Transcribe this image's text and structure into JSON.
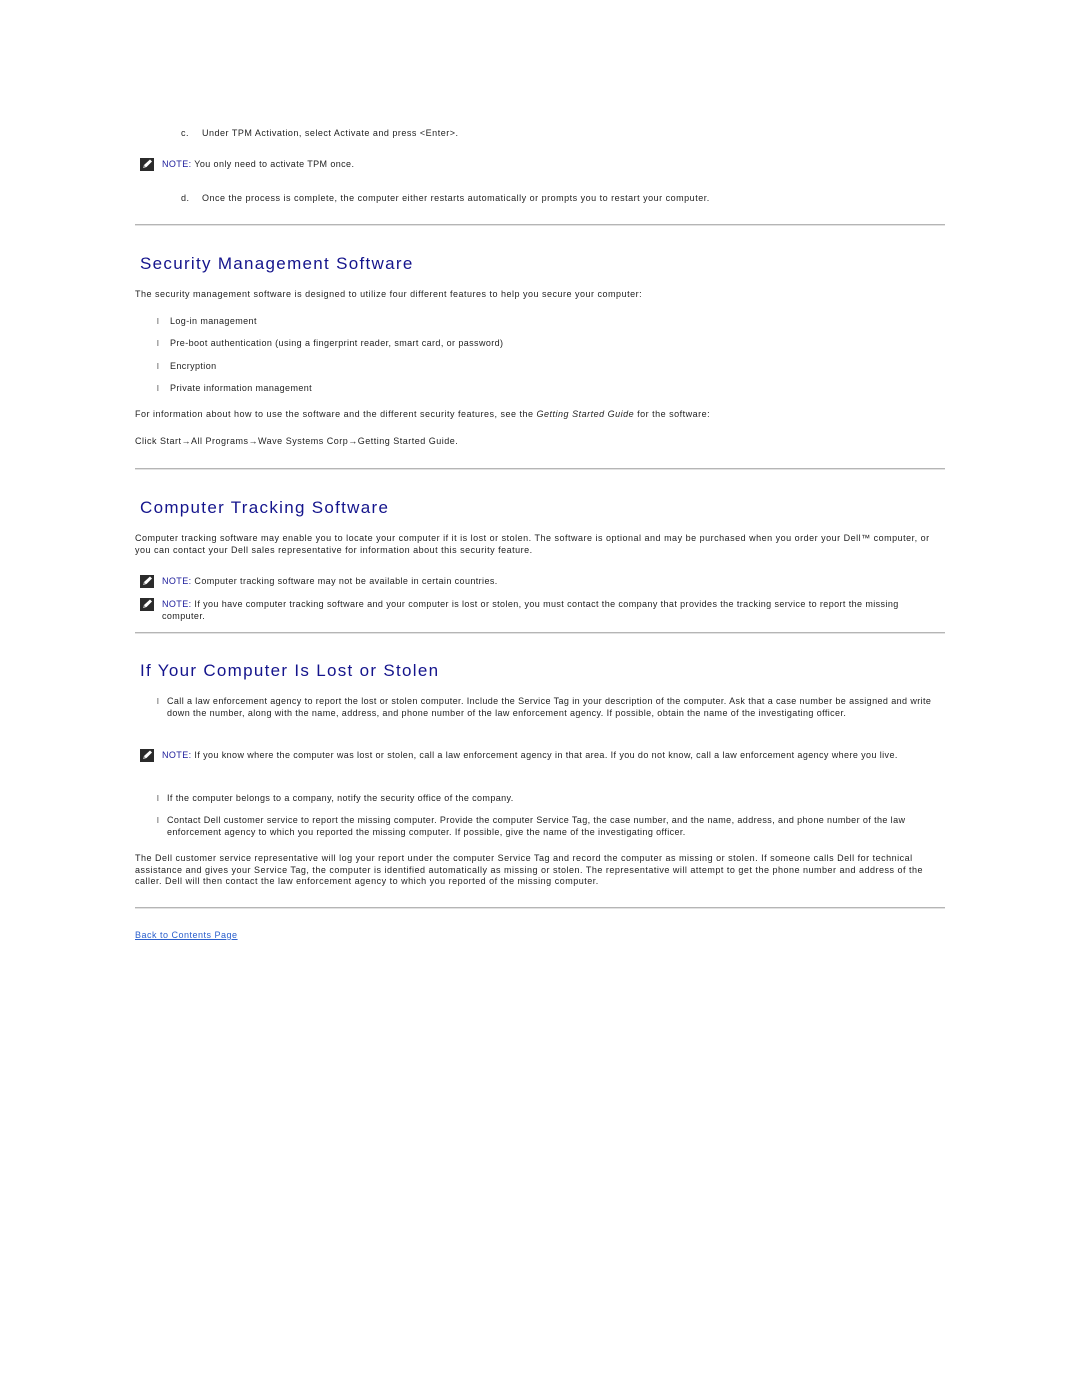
{
  "steps": [
    {
      "label": "c.",
      "text": "Under TPM Activation, select Activate and press <Enter>."
    },
    {
      "label": "d.",
      "text": "Once the process is complete, the computer either restarts automatically or prompts you to restart your computer."
    }
  ],
  "note_keyword": "NOTE:",
  "notes": {
    "tpm_once": "You only need to activate TPM once.",
    "tracking_unavailable": "Computer tracking software may not be available in certain countries.",
    "tracking_contact": "If you have computer tracking software and your computer is lost or stolen, you must contact the company that provides the tracking service to report the missing computer.",
    "know_location": "If you know where the computer was lost or stolen, call a law enforcement agency in that area. If you do not know, call a law enforcement agency where you live."
  },
  "sections": {
    "security": {
      "title": "Security Management Software",
      "intro": "The security management software is designed to utilize four different features to help you secure your computer:",
      "features": [
        "Log-in management",
        "Pre-boot authentication (using a fingerprint reader, smart card, or password)",
        "Encryption",
        "Private information management"
      ],
      "info_before": "For information about how to use the software and the different security features, see the ",
      "info_emph": "Getting Started Guide",
      "info_after": " for the software:",
      "click_path": "Click Start→All Programs→Wave Systems Corp→Getting Started Guide."
    },
    "tracking": {
      "title": "Computer Tracking Software",
      "intro": "Computer tracking software may enable you to locate your computer if it is lost or stolen. The software is optional and may be purchased when you order your Dell™ computer, or you can contact your Dell sales representative for information about this security feature."
    },
    "lost": {
      "title": "If Your Computer Is Lost or Stolen",
      "bullet_1": "Call a law enforcement agency to report the lost or stolen computer. Include the Service Tag in your description of the computer. Ask that a case number be assigned and write down the number, along with the name, address, and phone number of the law enforcement agency. If possible, obtain the name of the investigating officer.",
      "bullet_2": "If the computer belongs to a company, notify the security office of the company.",
      "bullet_3": "Contact Dell customer service to report the missing computer. Provide the computer Service Tag, the case number, and the name, address, and phone number of the law enforcement agency to which you reported the missing computer. If possible, give the name of the investigating officer.",
      "closing": "The Dell customer service representative will log your report under the computer Service Tag and record the computer as missing or stolen. If someone calls Dell for technical assistance and gives your Service Tag, the computer is identified automatically as missing or stolen. The representative will attempt to get the phone number and address of the caller. Dell will then contact the law enforcement agency to which you reported of the missing computer."
    }
  },
  "bullet_marker": "l",
  "back_link": "Back to Contents Page"
}
